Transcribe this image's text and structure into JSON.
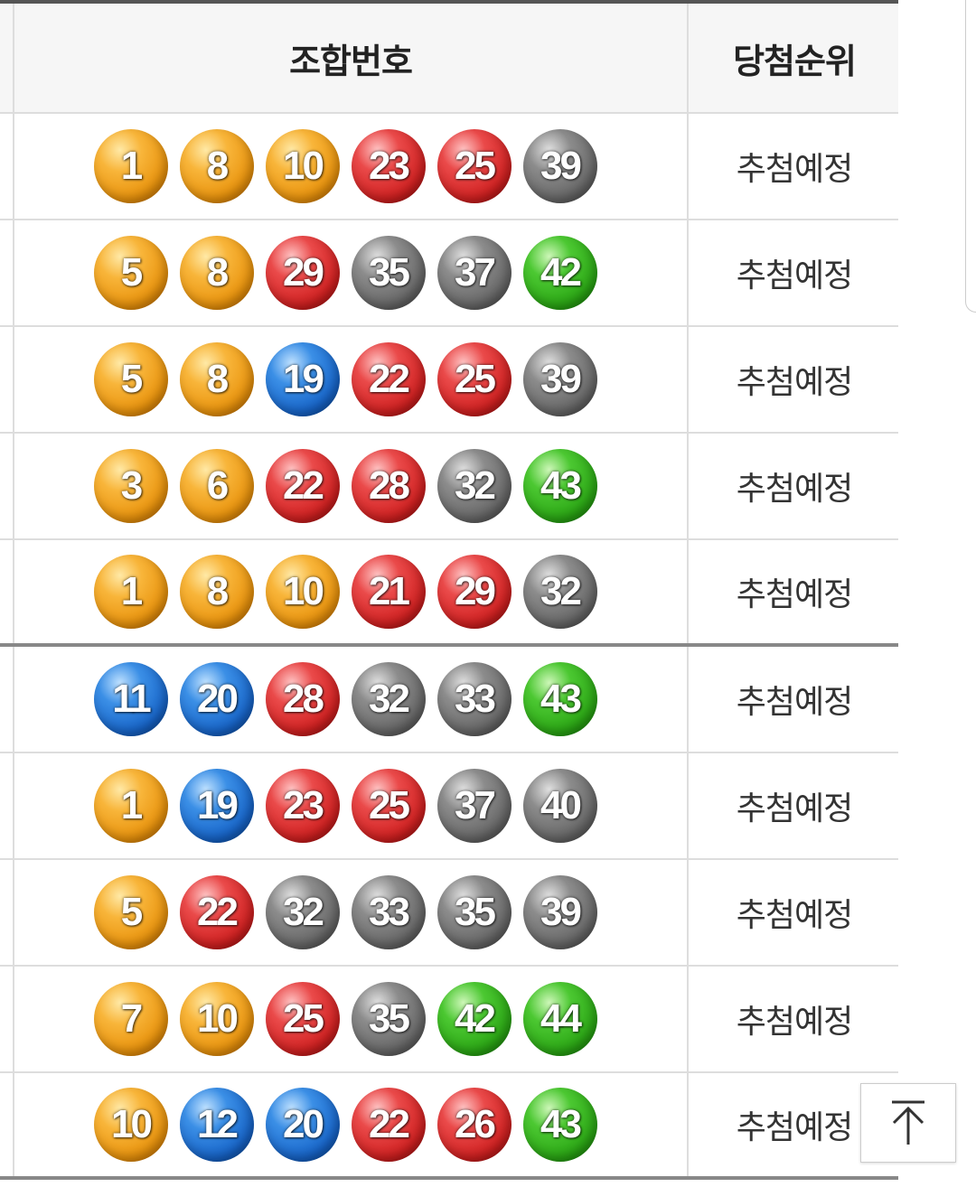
{
  "header": {
    "combo_label": "조합번호",
    "rank_label": "당첨순위"
  },
  "ball_colors": {
    "yellow": "#f8b53a",
    "blue": "#1764c8",
    "red": "#cf2020",
    "gray": "#666666",
    "green": "#2aa514"
  },
  "rows": [
    {
      "numbers": [
        "1",
        "8",
        "10",
        "23",
        "25",
        "39"
      ],
      "rank": "추첨예정"
    },
    {
      "numbers": [
        "5",
        "8",
        "29",
        "35",
        "37",
        "42"
      ],
      "rank": "추첨예정"
    },
    {
      "numbers": [
        "5",
        "8",
        "19",
        "22",
        "25",
        "39"
      ],
      "rank": "추첨예정"
    },
    {
      "numbers": [
        "3",
        "6",
        "22",
        "28",
        "32",
        "43"
      ],
      "rank": "추첨예정"
    },
    {
      "numbers": [
        "1",
        "8",
        "10",
        "21",
        "29",
        "32"
      ],
      "rank": "추첨예정"
    },
    {
      "numbers": [
        "11",
        "20",
        "28",
        "32",
        "33",
        "43"
      ],
      "rank": "추첨예정"
    },
    {
      "numbers": [
        "1",
        "19",
        "23",
        "25",
        "37",
        "40"
      ],
      "rank": "추첨예정"
    },
    {
      "numbers": [
        "5",
        "22",
        "32",
        "33",
        "35",
        "39"
      ],
      "rank": "추첨예정"
    },
    {
      "numbers": [
        "7",
        "10",
        "25",
        "35",
        "42",
        "44"
      ],
      "rank": "추첨예정"
    },
    {
      "numbers": [
        "10",
        "12",
        "20",
        "22",
        "26",
        "43"
      ],
      "rank": "추첨예정"
    }
  ],
  "scroll_top_icon": "arrow-up-to-top-icon"
}
